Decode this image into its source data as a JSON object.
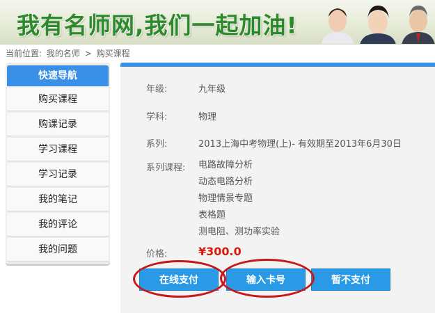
{
  "banner": {
    "slogan": "我有名师网,我们一起加油!"
  },
  "breadcrumb": {
    "prefix": "当前位置:",
    "home": "我的名师",
    "separator": ">",
    "current": "购买课程"
  },
  "sidebar": {
    "title": "快速导航",
    "items": [
      {
        "label": "购买课程"
      },
      {
        "label": "购课记录"
      },
      {
        "label": "学习课程"
      },
      {
        "label": "学习记录"
      },
      {
        "label": "我的笔记"
      },
      {
        "label": "我的评论"
      },
      {
        "label": "我的问题"
      }
    ]
  },
  "order": {
    "grade_label": "年级:",
    "grade": "九年级",
    "subject_label": "学科:",
    "subject": "物理",
    "series_label": "系列:",
    "series": "2013上海中考物理(上)- 有效期至2013年6月30日",
    "courses_label": "系列课程:",
    "courses": [
      "电路故障分析",
      "动态电路分析",
      "物理情景专题",
      "表格题",
      "测电阻、测功率实验"
    ],
    "price_label": "价格:",
    "price": "¥300.0"
  },
  "buttons": {
    "online_pay": "在线支付",
    "card_input": "输入卡号",
    "no_pay": "暂不支付"
  },
  "colors": {
    "accent": "#3a8fe6",
    "button": "#2a9ae6",
    "price": "#d61b0c",
    "annotation": "#c8171a",
    "slogan": "#2d8a2a"
  },
  "icons": {
    "banner_people": "people-photo-icon"
  }
}
